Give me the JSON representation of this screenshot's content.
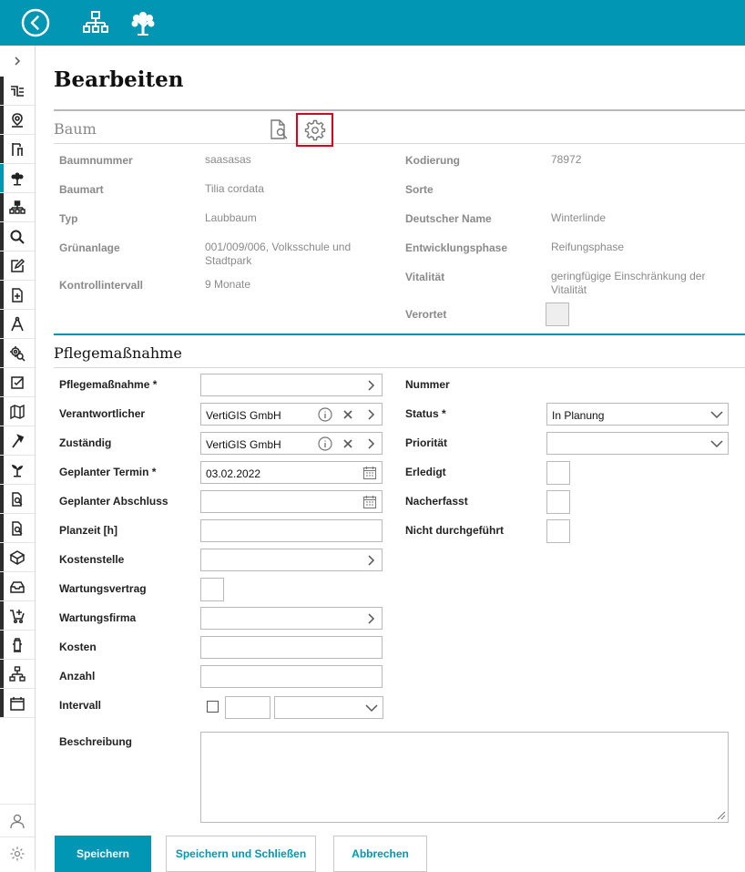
{
  "header": {
    "icons": [
      "back-circle-icon",
      "hierarchy-icon",
      "tree-icon"
    ]
  },
  "sidebar": {
    "items": [
      "pipe-icon",
      "map-pin-icon",
      "street-furniture-icon",
      "tree-icon",
      "hierarchy-icon",
      "search-icon",
      "edit-icon",
      "new-document-icon",
      "compass-icon",
      "gear-search-icon",
      "task-check-icon",
      "map-icon",
      "axe-icon",
      "plant-icon",
      "document-search-icon",
      "document-search-icon",
      "package-icon",
      "inbox-icon",
      "cart-add-icon",
      "hydrant-icon",
      "network-icon",
      "calendar-icon"
    ],
    "bottom": [
      "user-icon",
      "settings-icon"
    ]
  },
  "page": {
    "title": "Bearbeiten"
  },
  "baum": {
    "section_title": "Baum",
    "left": [
      {
        "label": "Baumnummer",
        "value": "saasasas"
      },
      {
        "label": "Baumart",
        "value": "Tilia cordata"
      },
      {
        "label": "Typ",
        "value": "Laubbaum"
      },
      {
        "label": "Grünanlage",
        "value": "001/009/006, Volksschule und Stadtpark"
      },
      {
        "label": "Kontrollintervall",
        "value": "9 Monate"
      }
    ],
    "right": [
      {
        "label": "Kodierung",
        "value": "78972"
      },
      {
        "label": "Sorte",
        "value": ""
      },
      {
        "label": "Deutscher Name",
        "value": "Winterlinde"
      },
      {
        "label": "Entwicklungsphase",
        "value": "Reifungsphase"
      },
      {
        "label": "Vitalität",
        "value": "geringfügige Einschränkung der Vitalität"
      },
      {
        "label": "Verortet",
        "value": ""
      }
    ]
  },
  "pflege": {
    "section_title": "Pflegemaßnahme",
    "left": [
      {
        "label": "Pflegemaßnahme *",
        "value": ""
      },
      {
        "label": "Verantwortlicher",
        "value": "VertiGIS GmbH"
      },
      {
        "label": "Zuständig",
        "value": "VertiGIS GmbH"
      },
      {
        "label": "Geplanter Termin *",
        "value": "03.02.2022"
      },
      {
        "label": "Geplanter Abschluss",
        "value": ""
      },
      {
        "label": "Planzeit [h]",
        "value": ""
      },
      {
        "label": "Kostenstelle",
        "value": ""
      },
      {
        "label": "Wartungsvertrag",
        "value": ""
      },
      {
        "label": "Wartungsfirma",
        "value": ""
      },
      {
        "label": "Kosten",
        "value": ""
      },
      {
        "label": "Anzahl",
        "value": ""
      },
      {
        "label": "Intervall",
        "value": ""
      },
      {
        "label": "Beschreibung",
        "value": ""
      }
    ],
    "right": [
      {
        "label": "Nummer",
        "value": ""
      },
      {
        "label": "Status *",
        "value": "In Planung"
      },
      {
        "label": "Priorität",
        "value": ""
      },
      {
        "label": "Erledigt",
        "value": ""
      },
      {
        "label": "Nacherfasst",
        "value": ""
      },
      {
        "label": "Nicht durchgeführt",
        "value": ""
      }
    ]
  },
  "buttons": {
    "save": "Speichern",
    "save_close": "Speichern und Schließen",
    "cancel": "Abbrechen"
  }
}
